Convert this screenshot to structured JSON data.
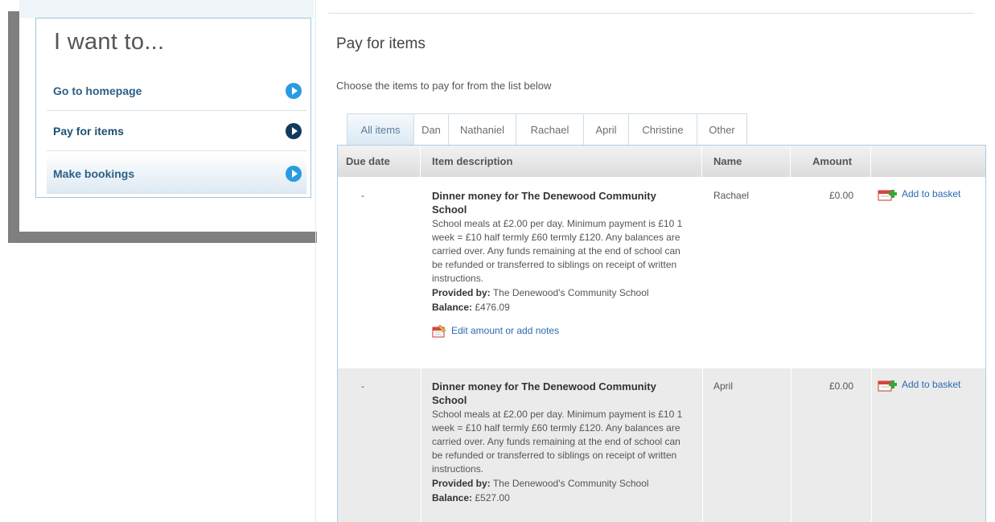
{
  "sidebar": {
    "title": "I want to...",
    "items": [
      {
        "label": "Go to homepage",
        "icon": "arrow-circle-icon"
      },
      {
        "label": "Pay for items",
        "icon": "arrow-circle-icon"
      },
      {
        "label": "Make bookings",
        "icon": "arrow-circle-icon"
      }
    ]
  },
  "main": {
    "title": "Pay for items",
    "subtitle": "Choose the items to pay for from the list below",
    "tabs": [
      "All items",
      "Dan",
      "Nathaniel",
      "Rachael",
      "April",
      "Christine",
      "Other"
    ],
    "table": {
      "headers": {
        "due_date": "Due date",
        "description": "Item description",
        "name": "Name",
        "amount": "Amount"
      },
      "rows": [
        {
          "due_date": "-",
          "title": "Dinner money for The Denewood Community School",
          "body": "School meals at £2.00 per day. Minimum payment is £10 1 week = £10 half termly £60 termly £120. Any balances are carried over. Any funds remaining at the end of school can be refunded or transferred to siblings on receipt of written instructions.",
          "provided_label": "Provided by:",
          "provided_value": "The Denewood's Community School",
          "balance_label": "Balance:",
          "balance_value": "£476.09",
          "edit_link": "Edit amount or add notes",
          "name": "Rachael",
          "amount": "£0.00",
          "action": "Add to basket"
        },
        {
          "due_date": "-",
          "title": "Dinner money for The Denewood Community School",
          "body": "School meals at £2.00 per day. Minimum payment is £10 1 week = £10 half termly £60 termly £120. Any balances are carried over. Any funds remaining at the end of school can be refunded or transferred to siblings on receipt of written instructions.",
          "provided_label": "Provided by:",
          "provided_value": "The Denewood's Community School",
          "balance_label": "Balance:",
          "balance_value": "£527.00",
          "name": "April",
          "amount": "£0.00",
          "action": "Add to basket"
        }
      ]
    }
  },
  "colors": {
    "accent_blue": "#2b9be0",
    "dark_navy": "#133a5c",
    "link_blue": "#2a6cb0",
    "border_blue": "#a9cde3"
  }
}
